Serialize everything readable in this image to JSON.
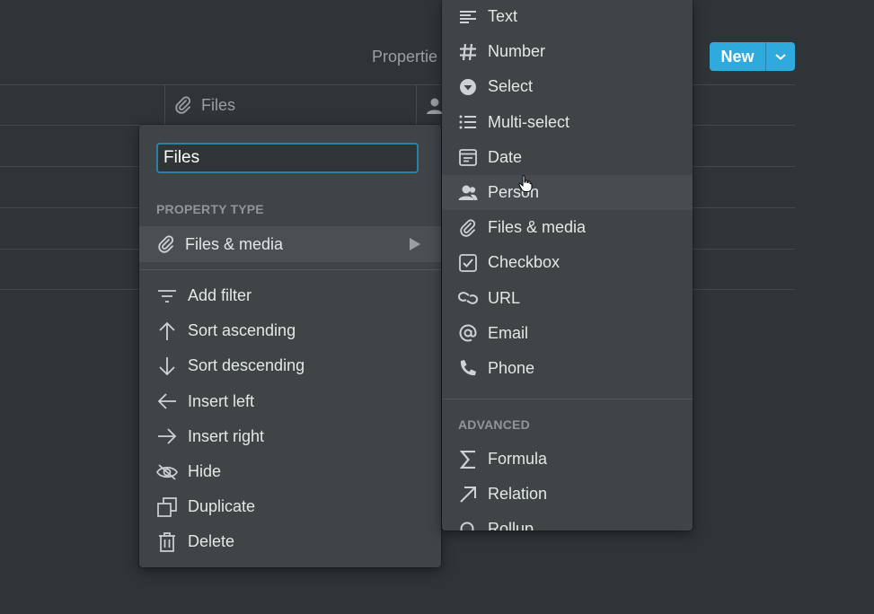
{
  "toolbar": {
    "properties_label": "Propertie",
    "new_button_label": "New"
  },
  "table": {
    "column_header_files": "Files"
  },
  "property_menu": {
    "name_value": "Files",
    "section_property_type": "PROPERTY TYPE",
    "current_type": "Files & media",
    "actions": [
      {
        "label": "Add filter",
        "icon": "filter-icon"
      },
      {
        "label": "Sort ascending",
        "icon": "arrow-up-icon"
      },
      {
        "label": "Sort descending",
        "icon": "arrow-down-icon"
      },
      {
        "label": "Insert left",
        "icon": "arrow-left-icon"
      },
      {
        "label": "Insert right",
        "icon": "arrow-right-icon"
      },
      {
        "label": "Hide",
        "icon": "eye-off-icon"
      },
      {
        "label": "Duplicate",
        "icon": "duplicate-icon"
      },
      {
        "label": "Delete",
        "icon": "trash-icon"
      }
    ]
  },
  "type_menu": {
    "basic_types": [
      {
        "label": "Text",
        "icon": "text-icon"
      },
      {
        "label": "Number",
        "icon": "hash-icon"
      },
      {
        "label": "Select",
        "icon": "select-icon"
      },
      {
        "label": "Multi-select",
        "icon": "list-icon"
      },
      {
        "label": "Date",
        "icon": "calendar-icon"
      },
      {
        "label": "Person",
        "icon": "person-icon"
      },
      {
        "label": "Files & media",
        "icon": "paperclip-icon"
      },
      {
        "label": "Checkbox",
        "icon": "checkbox-icon"
      },
      {
        "label": "URL",
        "icon": "link-icon"
      },
      {
        "label": "Email",
        "icon": "at-icon"
      },
      {
        "label": "Phone",
        "icon": "phone-icon"
      }
    ],
    "section_advanced": "ADVANCED",
    "advanced_types": [
      {
        "label": "Formula",
        "icon": "sigma-icon"
      },
      {
        "label": "Relation",
        "icon": "arrow-up-right-icon"
      },
      {
        "label": "Rollup",
        "icon": "search-icon"
      }
    ],
    "hovered_item": "Person"
  },
  "colors": {
    "background": "#2f3437",
    "menu": "#3f4447",
    "accent": "#2eaadc"
  }
}
